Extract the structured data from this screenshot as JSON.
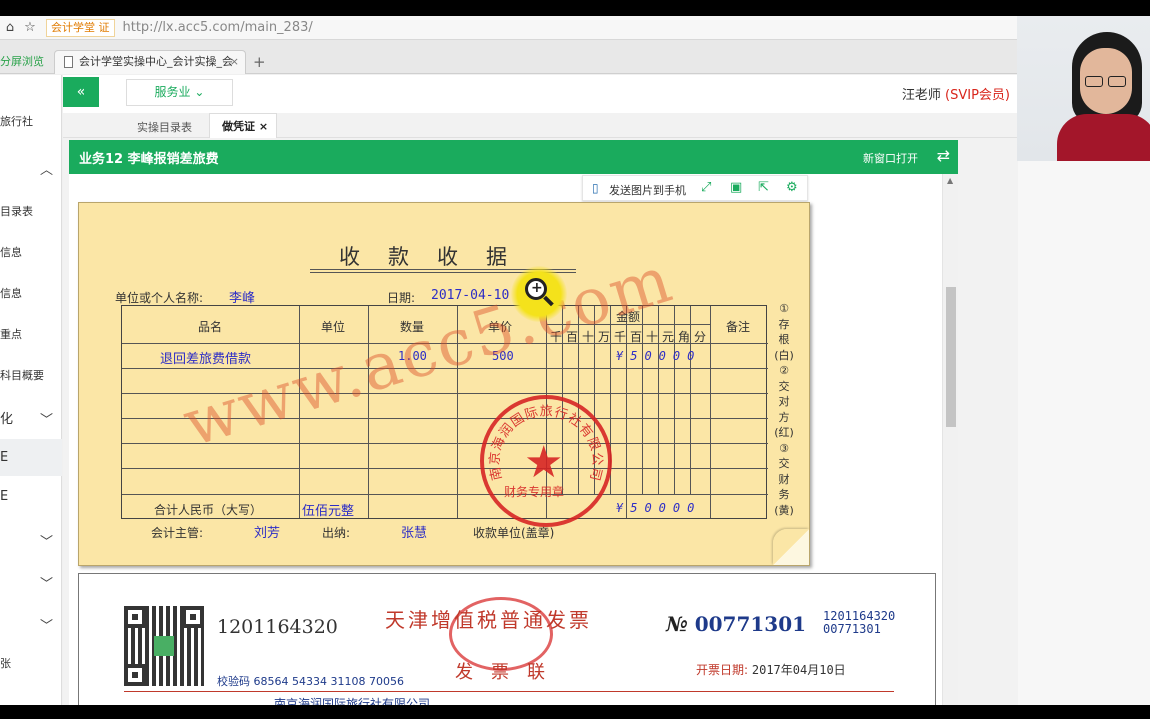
{
  "browser": {
    "site_label": "会计学堂",
    "site_badge": "证",
    "url": "http://lx.acc5.com/main_283/",
    "side_button": "分屏浏览",
    "tab_title": "会计学堂实操中心_会计实操_会",
    "new_tab": "+"
  },
  "left_nav": {
    "items": [
      {
        "label": "旅行社"
      },
      {
        "label": "目录表"
      },
      {
        "label": "信息"
      },
      {
        "label": "信息"
      },
      {
        "label": "重点"
      },
      {
        "label": "科目概要"
      },
      {
        "label": "化"
      },
      {
        "label": "E"
      },
      {
        "label": "E"
      },
      {
        "label": "张"
      }
    ]
  },
  "header": {
    "collapse_icon": "«",
    "business_select": "服务业",
    "user": "汪老师",
    "vip": "(SVIP会员)"
  },
  "subtabs": {
    "catalog": "实操目录表",
    "voucher": "做凭证",
    "close": "×"
  },
  "titlebar": {
    "title": "业务12 李峰报销差旅费",
    "open_new": "新窗口打开"
  },
  "toolbar": {
    "send_to_phone": "发送图片到手机"
  },
  "receipt": {
    "title": "收款收据",
    "payer_label": "单位或个人名称:",
    "payer": "李峰",
    "date_label": "日期:",
    "date": "2017-04-10",
    "headers": {
      "item": "品名",
      "unit": "单位",
      "qty": "数量",
      "price": "单价",
      "amount": "金额",
      "remark": "备注"
    },
    "digit_headers": [
      "千",
      "百",
      "十",
      "万",
      "千",
      "百",
      "十",
      "元",
      "角",
      "分"
    ],
    "row": {
      "item": "退回差旅费借款",
      "qty": "1.00",
      "price": "500"
    },
    "amount_row": "¥50000",
    "total_label": "合计人民币（大写）",
    "total_cn": "伍佰元整",
    "total_amount": "¥50000",
    "accountant_label": "会计主管:",
    "accountant": "刘芳",
    "cashier_label": "出纳:",
    "cashier": "张慧",
    "payee_label": "收款单位(盖章)",
    "side_notes": [
      "①",
      "存",
      "根",
      "(白)",
      "②",
      "交",
      "对",
      "方",
      "(红)",
      "③",
      "交",
      "财",
      "务",
      "(黄)"
    ],
    "stamp_ring": "南京海润国际旅行社有限公司",
    "stamp_bottom": "财务专用章",
    "watermark": "www.acc5.com"
  },
  "invoice": {
    "code": "1201164320",
    "check_label": "校验码",
    "check_code": "68564 54334 31108 70056",
    "title": "天津增值税普通发票",
    "copy": "发票联",
    "no_label": "№",
    "number": "00771301",
    "small_code": "1201164320",
    "small_number": "00771301",
    "date_label": "开票日期:",
    "date": "2017年04月10日",
    "company": "南京海润国际旅行社有限公司"
  }
}
